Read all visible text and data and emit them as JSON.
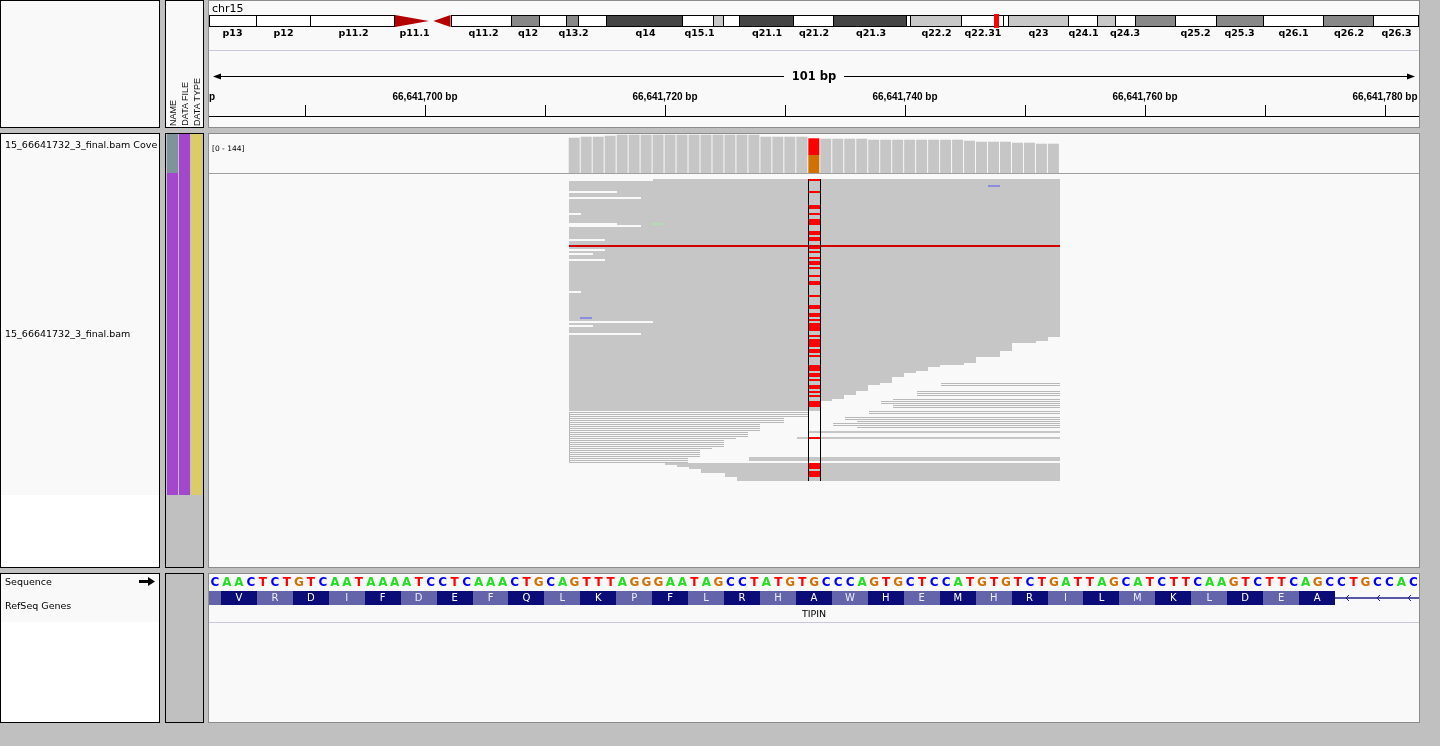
{
  "header": {
    "attribute_columns": [
      "NAME",
      "DATA FILE",
      "DATA TYPE"
    ],
    "chromosome": "chr15",
    "ideogram": {
      "bands": [
        {
          "label": "p13",
          "kind": "plain",
          "in_view": false
        },
        {
          "label": "p12",
          "kind": "plain",
          "in_view": false
        },
        {
          "label": "p11.2",
          "kind": "plain",
          "in_view": false
        },
        {
          "label": "p11.1",
          "kind": "centromere",
          "in_view": false
        },
        {
          "kind": "centromere",
          "in_view": false
        },
        {
          "label": "q11.2",
          "kind": "plain",
          "in_view": false
        },
        {
          "label": "q12",
          "kind": "medium",
          "in_view": false
        },
        {
          "kind": "plain",
          "in_view": false
        },
        {
          "label": "q13.2",
          "kind": "medium",
          "in_view": false
        },
        {
          "kind": "plain",
          "in_view": false
        },
        {
          "label": "q14",
          "kind": "dark",
          "in_view": false
        },
        {
          "label": "q15.1",
          "kind": "plain",
          "in_view": false
        },
        {
          "kind": "light",
          "in_view": false
        },
        {
          "kind": "plain",
          "in_view": false
        },
        {
          "label": "q21.1",
          "kind": "dark",
          "in_view": false
        },
        {
          "label": "q21.2",
          "kind": "plain",
          "in_view": false
        },
        {
          "label": "q21.3",
          "kind": "dark",
          "in_view": false
        },
        {
          "kind": "plain",
          "in_view": false
        },
        {
          "label": "q22.2",
          "kind": "light",
          "in_view": false
        },
        {
          "label": "q22.31",
          "kind": "plain",
          "in_view": true
        },
        {
          "kind": "plain",
          "in_view": false
        },
        {
          "label": "q23",
          "kind": "light",
          "in_view": false
        },
        {
          "label": "q24.1",
          "kind": "plain",
          "in_view": false
        },
        {
          "kind": "light",
          "in_view": false
        },
        {
          "label": "q24.3",
          "kind": "plain",
          "in_view": false
        },
        {
          "kind": "medium",
          "in_view": false
        },
        {
          "label": "q25.2",
          "kind": "plain",
          "in_view": false
        },
        {
          "label": "q25.3",
          "kind": "medium",
          "in_view": false
        },
        {
          "label": "q26.1",
          "kind": "plain",
          "in_view": false
        },
        {
          "label": "q26.2",
          "kind": "medium",
          "in_view": false
        },
        {
          "label": "q26.3",
          "kind": "plain",
          "in_view": false
        }
      ]
    },
    "ruler": {
      "span": "101 bp",
      "edge_label": "p",
      "tick_labels": [
        "66,641,700 bp",
        "66,641,720 bp",
        "66,641,740 bp",
        "66,641,760 bp",
        "66,641,780 bp"
      ]
    }
  },
  "data_panel": {
    "tracks": [
      {
        "kind": "coverage",
        "name": "15_66641732_3_final.bam Cove",
        "attributes": [
          {
            "color": "#7f939b"
          },
          {
            "color": "#a347cc"
          },
          {
            "color": "#dccb69"
          }
        ],
        "range_label": "[0 - 144]"
      },
      {
        "kind": "alignments",
        "name": "15_66641732_3_final.bam",
        "attributes": [
          {
            "color": "#a347cc"
          },
          {
            "color": "#a347cc"
          },
          {
            "color": "#dccb69"
          }
        ]
      }
    ]
  },
  "feature_panel": {
    "tracks": [
      {
        "kind": "sequence",
        "name": "Sequence",
        "reverse_strand": false,
        "bases": [
          {
            "base": "C",
            "color": "#0000ff"
          },
          {
            "base": "A",
            "color": "#22dd22"
          },
          {
            "base": "A",
            "color": "#22dd22"
          },
          {
            "base": "C",
            "color": "#0000ff"
          },
          {
            "base": "T",
            "color": "#ff0000"
          },
          {
            "base": "C",
            "color": "#0000ff"
          },
          {
            "base": "T",
            "color": "#ff0000"
          },
          {
            "base": "G",
            "color": "#d17105"
          },
          {
            "base": "T",
            "color": "#ff0000"
          },
          {
            "base": "C",
            "color": "#0000ff"
          },
          {
            "base": "A",
            "color": "#22dd22"
          },
          {
            "base": "A",
            "color": "#22dd22"
          },
          {
            "base": "T",
            "color": "#ff0000"
          },
          {
            "base": "A",
            "color": "#22dd22"
          },
          {
            "base": "A",
            "color": "#22dd22"
          },
          {
            "base": "A",
            "color": "#22dd22"
          },
          {
            "base": "A",
            "color": "#22dd22"
          },
          {
            "base": "T",
            "color": "#ff0000"
          },
          {
            "base": "C",
            "color": "#0000ff"
          },
          {
            "base": "C",
            "color": "#0000ff"
          },
          {
            "base": "T",
            "color": "#ff0000"
          },
          {
            "base": "C",
            "color": "#0000ff"
          },
          {
            "base": "A",
            "color": "#22dd22"
          },
          {
            "base": "A",
            "color": "#22dd22"
          },
          {
            "base": "A",
            "color": "#22dd22"
          },
          {
            "base": "C",
            "color": "#0000ff"
          },
          {
            "base": "T",
            "color": "#ff0000"
          },
          {
            "base": "G",
            "color": "#d17105"
          },
          {
            "base": "C",
            "color": "#0000ff"
          },
          {
            "base": "A",
            "color": "#22dd22"
          },
          {
            "base": "G",
            "color": "#d17105"
          },
          {
            "base": "T",
            "color": "#ff0000"
          },
          {
            "base": "T",
            "color": "#ff0000"
          },
          {
            "base": "T",
            "color": "#ff0000"
          },
          {
            "base": "A",
            "color": "#22dd22"
          },
          {
            "base": "G",
            "color": "#d17105"
          },
          {
            "base": "G",
            "color": "#d17105"
          },
          {
            "base": "G",
            "color": "#d17105"
          },
          {
            "base": "A",
            "color": "#22dd22"
          },
          {
            "base": "A",
            "color": "#22dd22"
          },
          {
            "base": "T",
            "color": "#ff0000"
          },
          {
            "base": "A",
            "color": "#22dd22"
          },
          {
            "base": "G",
            "color": "#d17105"
          },
          {
            "base": "C",
            "color": "#0000ff"
          },
          {
            "base": "C",
            "color": "#0000ff"
          },
          {
            "base": "T",
            "color": "#ff0000"
          },
          {
            "base": "A",
            "color": "#22dd22"
          },
          {
            "base": "T",
            "color": "#ff0000"
          },
          {
            "base": "G",
            "color": "#d17105"
          },
          {
            "base": "T",
            "color": "#ff0000"
          },
          {
            "base": "G",
            "color": "#d17105"
          },
          {
            "base": "C",
            "color": "#0000ff"
          },
          {
            "base": "C",
            "color": "#0000ff"
          },
          {
            "base": "C",
            "color": "#0000ff"
          },
          {
            "base": "A",
            "color": "#22dd22"
          },
          {
            "base": "G",
            "color": "#d17105"
          },
          {
            "base": "T",
            "color": "#ff0000"
          },
          {
            "base": "G",
            "color": "#d17105"
          },
          {
            "base": "C",
            "color": "#0000ff"
          },
          {
            "base": "T",
            "color": "#ff0000"
          },
          {
            "base": "C",
            "color": "#0000ff"
          },
          {
            "base": "C",
            "color": "#0000ff"
          },
          {
            "base": "A",
            "color": "#22dd22"
          },
          {
            "base": "T",
            "color": "#ff0000"
          },
          {
            "base": "G",
            "color": "#d17105"
          },
          {
            "base": "T",
            "color": "#ff0000"
          },
          {
            "base": "G",
            "color": "#d17105"
          },
          {
            "base": "T",
            "color": "#ff0000"
          },
          {
            "base": "C",
            "color": "#0000ff"
          },
          {
            "base": "T",
            "color": "#ff0000"
          },
          {
            "base": "G",
            "color": "#d17105"
          },
          {
            "base": "A",
            "color": "#22dd22"
          },
          {
            "base": "T",
            "color": "#ff0000"
          },
          {
            "base": "T",
            "color": "#ff0000"
          },
          {
            "base": "A",
            "color": "#22dd22"
          },
          {
            "base": "G",
            "color": "#d17105"
          },
          {
            "base": "C",
            "color": "#0000ff"
          },
          {
            "base": "A",
            "color": "#22dd22"
          },
          {
            "base": "T",
            "color": "#ff0000"
          },
          {
            "base": "C",
            "color": "#0000ff"
          },
          {
            "base": "T",
            "color": "#ff0000"
          },
          {
            "base": "T",
            "color": "#ff0000"
          },
          {
            "base": "C",
            "color": "#0000ff"
          },
          {
            "base": "A",
            "color": "#22dd22"
          },
          {
            "base": "A",
            "color": "#22dd22"
          },
          {
            "base": "G",
            "color": "#d17105"
          },
          {
            "base": "T",
            "color": "#ff0000"
          },
          {
            "base": "C",
            "color": "#0000ff"
          },
          {
            "base": "T",
            "color": "#ff0000"
          },
          {
            "base": "T",
            "color": "#ff0000"
          },
          {
            "base": "C",
            "color": "#0000ff"
          },
          {
            "base": "A",
            "color": "#22dd22"
          },
          {
            "base": "G",
            "color": "#d17105"
          },
          {
            "base": "C",
            "color": "#0000ff"
          },
          {
            "base": "C",
            "color": "#0000ff"
          },
          {
            "base": "T",
            "color": "#ff0000"
          },
          {
            "base": "G",
            "color": "#d17105"
          },
          {
            "base": "C",
            "color": "#0000ff"
          },
          {
            "base": "C",
            "color": "#0000ff"
          },
          {
            "base": "A",
            "color": "#22dd22"
          },
          {
            "base": "C",
            "color": "#0000ff"
          }
        ]
      },
      {
        "kind": "gene",
        "name": "RefSeq Genes",
        "gene": "TIPIN",
        "reverse_strand": true,
        "amino_acids": [
          "V",
          "R",
          "D",
          "I",
          "F",
          "D",
          "E",
          "F",
          "Q",
          "L",
          "K",
          "P",
          "F",
          "L",
          "R",
          "H",
          "A",
          "W",
          "H",
          "E",
          "M",
          "H",
          "R",
          "I",
          "L",
          "M",
          "K",
          "L",
          "D",
          "E",
          "A"
        ]
      }
    ]
  }
}
